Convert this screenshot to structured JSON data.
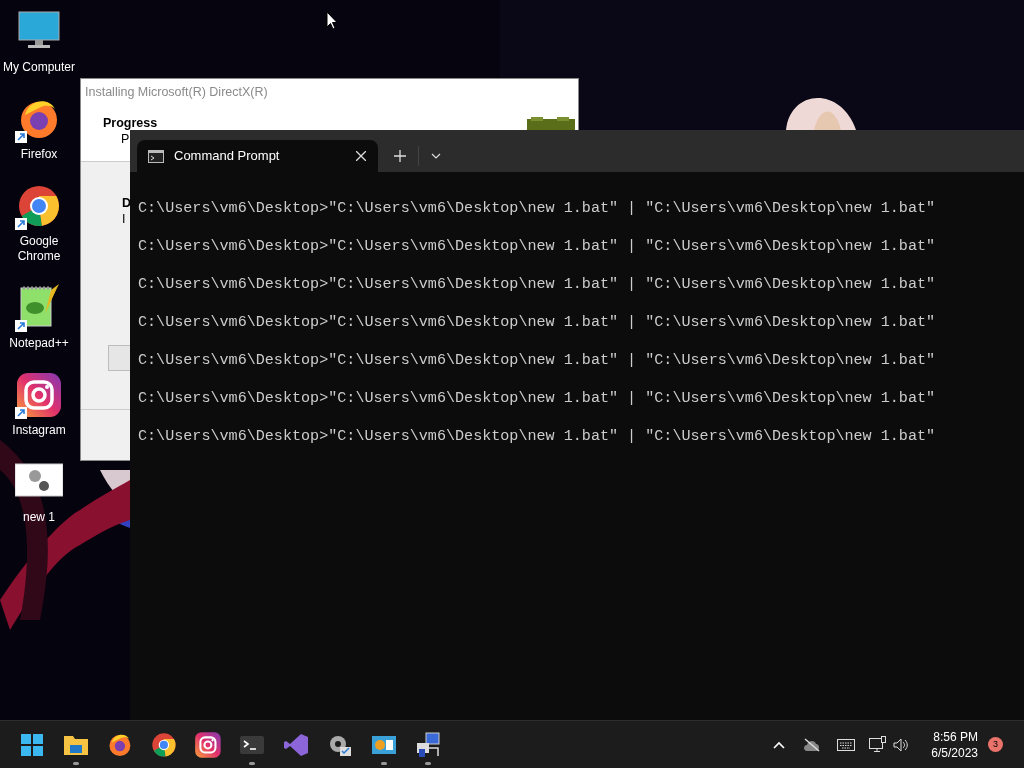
{
  "desktop_icons": [
    {
      "kind": "computer",
      "label": "My Computer",
      "shortcut": false
    },
    {
      "kind": "firefox",
      "label": "Firefox",
      "shortcut": true
    },
    {
      "kind": "chrome",
      "label": "Google Chrome",
      "shortcut": true
    },
    {
      "kind": "notepad",
      "label": "Notepad++",
      "shortcut": true
    },
    {
      "kind": "instagram",
      "label": "Instagram",
      "shortcut": true
    },
    {
      "kind": "batch",
      "label": "new 1",
      "shortcut": false
    }
  ],
  "installer_window": {
    "title": "Installing Microsoft(R) DirectX(R)",
    "heading": "Progress",
    "subheading": "P",
    "status_title": "D",
    "status_text": "I"
  },
  "terminal": {
    "tab_title": "Command Prompt",
    "lines": [
      "C:\\Users\\vm6\\Desktop>\"C:\\Users\\vm6\\Desktop\\new 1.bat\" | \"C:\\Users\\vm6\\Desktop\\new 1.bat\"",
      "C:\\Users\\vm6\\Desktop>\"C:\\Users\\vm6\\Desktop\\new 1.bat\" | \"C:\\Users\\vm6\\Desktop\\new 1.bat\"",
      "C:\\Users\\vm6\\Desktop>\"C:\\Users\\vm6\\Desktop\\new 1.bat\" | \"C:\\Users\\vm6\\Desktop\\new 1.bat\"",
      "C:\\Users\\vm6\\Desktop>\"C:\\Users\\vm6\\Desktop\\new 1.bat\" | \"C:\\Users\\vm6\\Desktop\\new 1.bat\"",
      "C:\\Users\\vm6\\Desktop>\"C:\\Users\\vm6\\Desktop\\new 1.bat\" | \"C:\\Users\\vm6\\Desktop\\new 1.bat\"",
      "C:\\Users\\vm6\\Desktop>\"C:\\Users\\vm6\\Desktop\\new 1.bat\" | \"C:\\Users\\vm6\\Desktop\\new 1.bat\"",
      "C:\\Users\\vm6\\Desktop>\"C:\\Users\\vm6\\Desktop\\new 1.bat\" | \"C:\\Users\\vm6\\Desktop\\new 1.bat\""
    ]
  },
  "taskbar": {
    "items": [
      {
        "kind": "start",
        "running": false
      },
      {
        "kind": "explorer",
        "running": true
      },
      {
        "kind": "firefox",
        "running": false
      },
      {
        "kind": "chrome",
        "running": false
      },
      {
        "kind": "instagram",
        "running": false
      },
      {
        "kind": "terminal",
        "running": true
      },
      {
        "kind": "visualstudio",
        "running": false
      },
      {
        "kind": "settings",
        "running": false
      },
      {
        "kind": "control",
        "running": true
      },
      {
        "kind": "network",
        "running": true
      }
    ],
    "time": "8:56 PM",
    "date": "6/5/2023",
    "notification_count": "3"
  }
}
